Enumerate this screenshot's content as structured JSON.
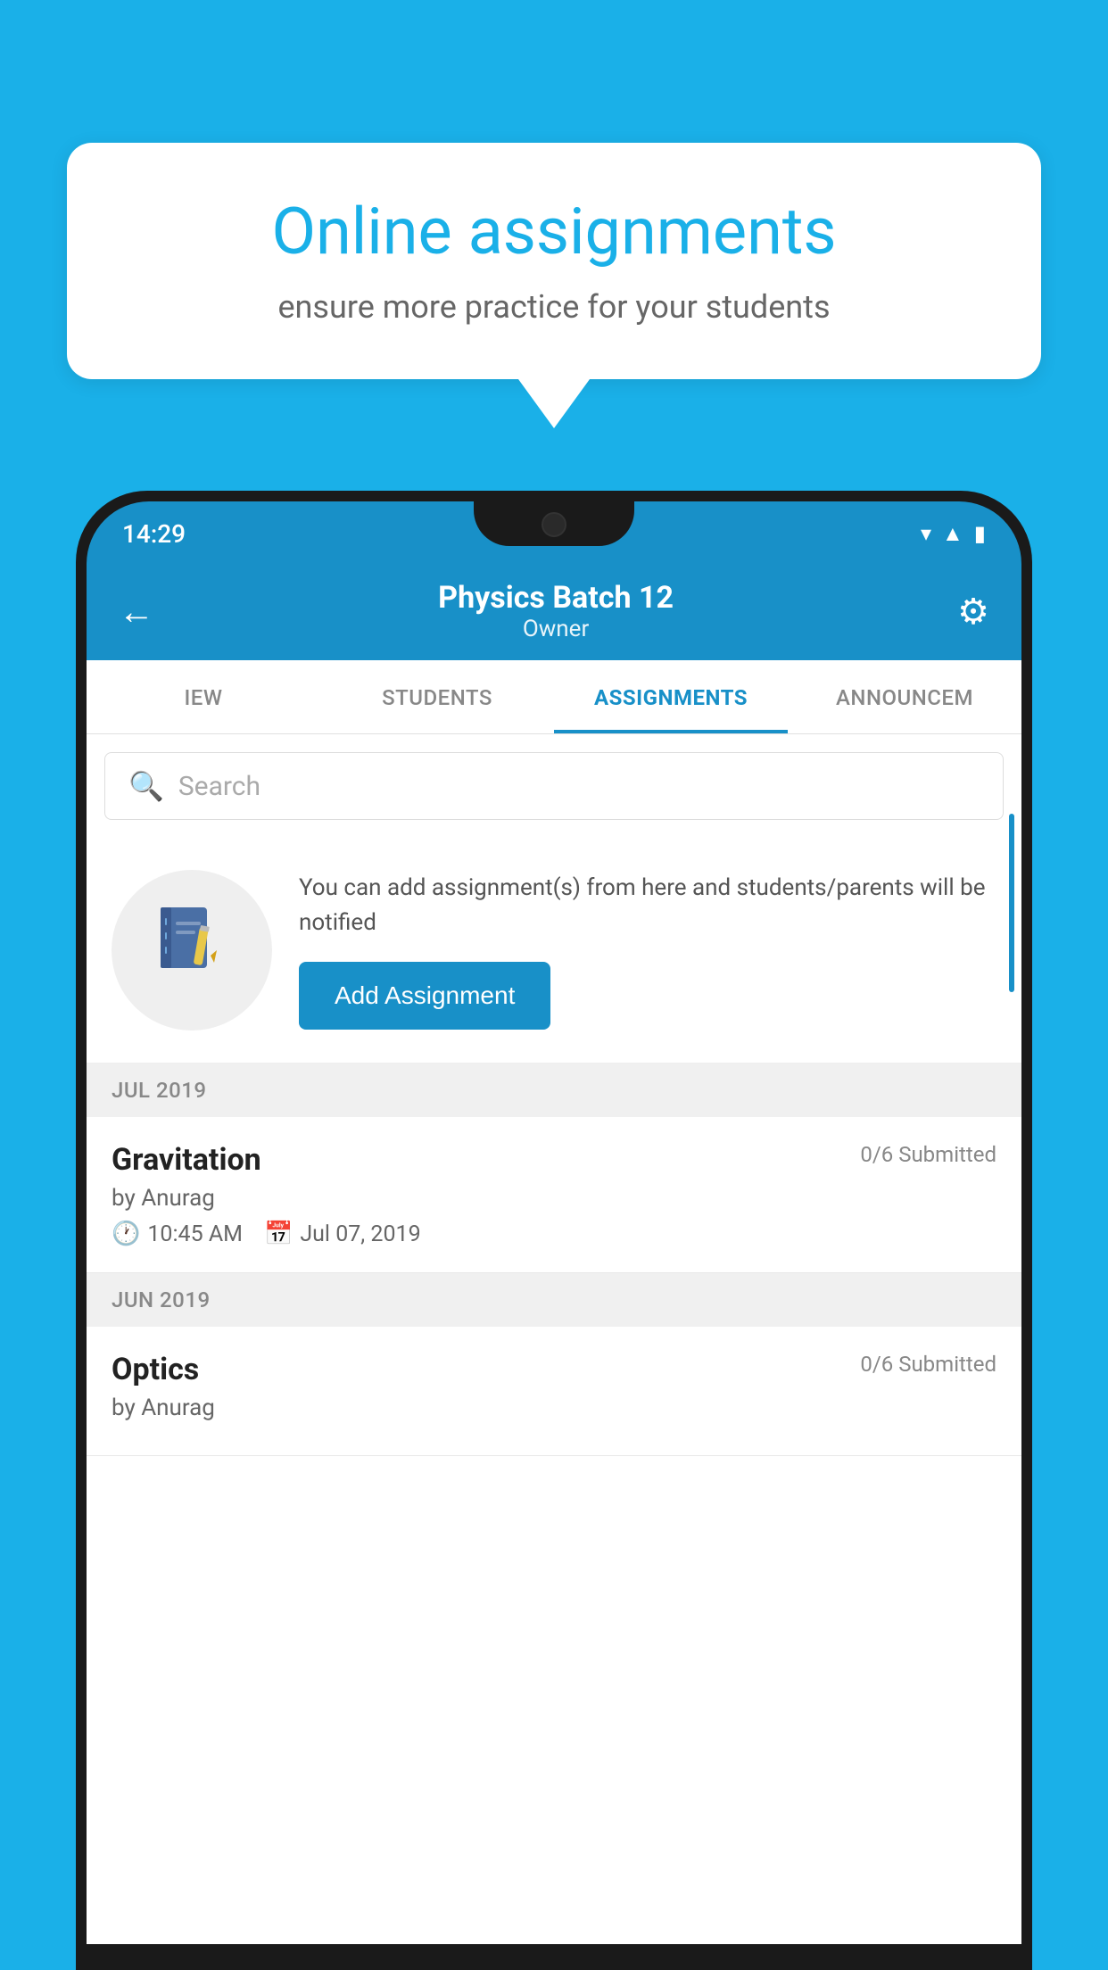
{
  "background_color": "#1ab0e8",
  "speech_bubble": {
    "title": "Online assignments",
    "subtitle": "ensure more practice for your students"
  },
  "phone": {
    "status_bar": {
      "time": "14:29",
      "icons": [
        "wifi",
        "signal",
        "battery"
      ]
    },
    "header": {
      "title": "Physics Batch 12",
      "subtitle": "Owner",
      "back_label": "←",
      "settings_label": "⚙"
    },
    "tabs": [
      {
        "label": "IEW",
        "active": false
      },
      {
        "label": "STUDENTS",
        "active": false
      },
      {
        "label": "ASSIGNMENTS",
        "active": true
      },
      {
        "label": "ANNOUNCEM",
        "active": false
      }
    ],
    "search": {
      "placeholder": "Search",
      "icon": "🔍"
    },
    "add_assignment_section": {
      "icon": "📓",
      "cta_text": "You can add assignment(s) from here and students/parents will be notified",
      "button_label": "Add Assignment"
    },
    "sections": [
      {
        "header": "JUL 2019",
        "items": [
          {
            "name": "Gravitation",
            "status": "0/6 Submitted",
            "by": "by Anurag",
            "time": "10:45 AM",
            "date": "Jul 07, 2019"
          }
        ]
      },
      {
        "header": "JUN 2019",
        "items": [
          {
            "name": "Optics",
            "status": "0/6 Submitted",
            "by": "by Anurag",
            "time": "",
            "date": ""
          }
        ]
      }
    ]
  }
}
